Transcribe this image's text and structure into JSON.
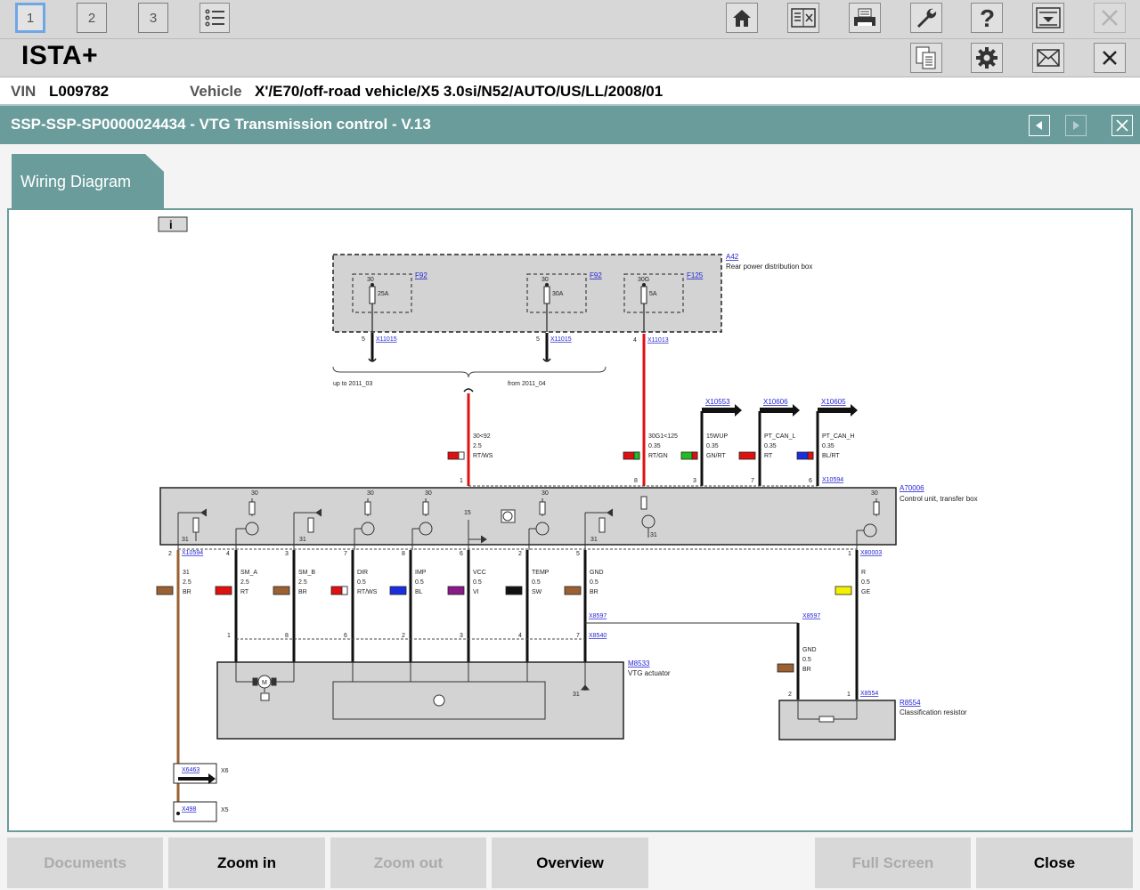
{
  "toolbar": {
    "tabs": [
      "1",
      "2",
      "3"
    ]
  },
  "app": {
    "title": "ISTA+"
  },
  "vehicle_info": {
    "vin_label": "VIN",
    "vin_value": "L009782",
    "vehicle_label": "Vehicle",
    "vehicle_value": "X'/E70/off-road vehicle/X5 3.0si/N52/AUTO/US/LL/2008/01"
  },
  "document": {
    "title": "SSP-SSP-SP0000024434 - VTG Transmission control - V.13",
    "section_tab": "Wiring Diagram"
  },
  "diagram": {
    "a42_ref": "A42",
    "a42_name": "Rear power distribution box",
    "f1_ref": "F92",
    "f1_term": "30",
    "f1_rating": "25A",
    "f2_ref": "F92",
    "f2_term": "30",
    "f2_rating": "30A",
    "f3_ref": "F125",
    "f3_term": "30G",
    "f3_rating": "5A",
    "p1_pin": "5",
    "p1_conn": "X11015",
    "p2_pin": "5",
    "p2_conn": "X11015",
    "p3_pin": "4",
    "p3_conn": "X11013",
    "variant_old": "up to 2011_03",
    "variant_new": "from 2011_04",
    "w1_sig": "30<92",
    "w1_size": "2.5",
    "w1_color": "RT/WS",
    "w2_sig": "30G1<125",
    "w2_size": "0.35",
    "w2_color": "RT/GN",
    "w3_conn": "X10553",
    "w3_sig": "15WUP",
    "w3_size": "0.35",
    "w3_color": "GN/RT",
    "w4_conn": "X10606",
    "w4_sig": "PT_CAN_L",
    "w4_size": "0.35",
    "w4_color": "RT",
    "w5_conn": "X10605",
    "w5_sig": "PT_CAN_H",
    "w5_size": "0.35",
    "w5_color": "BL/RT",
    "top_pins": [
      "1",
      "8",
      "3",
      "7",
      "6"
    ],
    "top_conn": "X10594",
    "a70_ref": "A70006",
    "a70_name": "Control unit, transfer box",
    "term_30": "30",
    "term_31": "31",
    "term_15": "15",
    "bot_conn_left": "X10594",
    "bot_conn_right": "X80003",
    "bot_pins": [
      "2",
      "4",
      "3",
      "7",
      "8",
      "6",
      "2",
      "5",
      "1"
    ],
    "b1_sig": "31",
    "b1_size": "2.5",
    "b1_color": "BR",
    "b2_sig": "SM_A",
    "b2_size": "2.5",
    "b2_color": "RT",
    "b3_sig": "SM_B",
    "b3_size": "2.5",
    "b3_color": "BR",
    "b4_sig": "DIR",
    "b4_size": "0.5",
    "b4_color": "RT/WS",
    "b5_sig": "IMP",
    "b5_size": "0.5",
    "b5_color": "BL",
    "b6_sig": "VCC",
    "b6_size": "0.5",
    "b6_color": "VI",
    "b7_sig": "TEMP",
    "b7_size": "0.5",
    "b7_color": "SW",
    "b8_sig": "GND",
    "b8_size": "0.5",
    "b8_color": "BR",
    "b9_sig": "R",
    "b9_size": "0.5",
    "b9_color": "GE",
    "x8597": "X8597",
    "x8540": "X8540",
    "act_pins": [
      "1",
      "8",
      "6",
      "2",
      "3",
      "4",
      "7"
    ],
    "m_ref": "M8533",
    "m_name": "VTG actuator",
    "g_sig": "GND",
    "g_size": "0.5",
    "g_color": "BR",
    "r_pins": [
      "2",
      "1"
    ],
    "r_conn": "X8554",
    "r_ref": "R8554",
    "r_name": "Classification resistor",
    "x6463": "X6463",
    "x6": "X6",
    "x498": "X498",
    "x5": "X5",
    "motor_letter": "M"
  },
  "bottom_buttons": {
    "documents": "Documents",
    "zoom_in": "Zoom in",
    "zoom_out": "Zoom out",
    "overview": "Overview",
    "full_screen": "Full Screen",
    "close": "Close"
  }
}
